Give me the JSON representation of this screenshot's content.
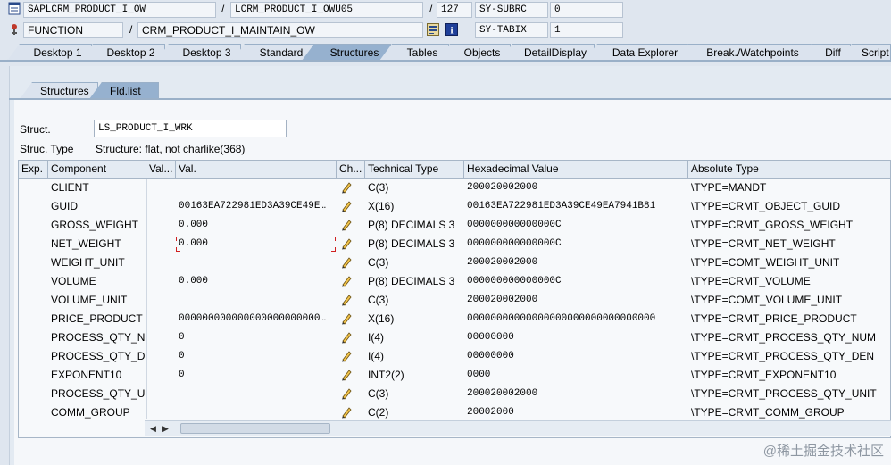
{
  "header": {
    "program": "SAPLCRM_PRODUCT_I_OW",
    "include": "LCRM_PRODUCT_I_OWU05",
    "line": "127",
    "var1_name": "SY-SUBRC",
    "var1_value": "0",
    "event_type": "FUNCTION",
    "event_name": "CRM_PRODUCT_I_MAINTAIN_OW",
    "var2_name": "SY-TABIX",
    "var2_value": "1"
  },
  "tabs": [
    "Desktop 1",
    "Desktop 2",
    "Desktop 3",
    "Standard",
    "Structures",
    "Tables",
    "Objects",
    "DetailDisplay",
    "Data Explorer",
    "Break./Watchpoints",
    "Diff",
    "Script"
  ],
  "active_tab": "Structures",
  "subtabs": [
    "Structures",
    "Fld.list"
  ],
  "active_subtab": "Fld.list",
  "struct": {
    "label": "Struct.",
    "value": "LS_PRODUCT_I_WRK",
    "type_label": "Struc. Type",
    "type_value": "Structure: flat, not charlike(368)"
  },
  "table": {
    "columns": [
      "Exp.",
      "Component",
      "Val...",
      "Val.",
      "Ch...",
      "Technical Type",
      "Hexadecimal Value",
      "Absolute Type"
    ],
    "rows": [
      {
        "component": "CLIENT",
        "val": "",
        "tech": "C(3)",
        "hex": "200020002000",
        "abs": "\\TYPE=MANDT"
      },
      {
        "component": "GUID",
        "val": "00163EA722981ED3A39CE49E…",
        "tech": "X(16)",
        "hex": "00163EA722981ED3A39CE49EA7941B81",
        "abs": "\\TYPE=CRMT_OBJECT_GUID"
      },
      {
        "component": "GROSS_WEIGHT",
        "val": "0.000",
        "tech": "P(8) DECIMALS 3",
        "hex": "000000000000000C",
        "abs": "\\TYPE=CRMT_GROSS_WEIGHT"
      },
      {
        "component": "NET_WEIGHT",
        "val": "0.000",
        "tech": "P(8) DECIMALS 3",
        "hex": "000000000000000C",
        "abs": "\\TYPE=CRMT_NET_WEIGHT"
      },
      {
        "component": "WEIGHT_UNIT",
        "val": "",
        "tech": "C(3)",
        "hex": "200020002000",
        "abs": "\\TYPE=COMT_WEIGHT_UNIT"
      },
      {
        "component": "VOLUME",
        "val": "0.000",
        "tech": "P(8) DECIMALS 3",
        "hex": "000000000000000C",
        "abs": "\\TYPE=CRMT_VOLUME"
      },
      {
        "component": "VOLUME_UNIT",
        "val": "",
        "tech": "C(3)",
        "hex": "200020002000",
        "abs": "\\TYPE=COMT_VOLUME_UNIT"
      },
      {
        "component": "PRICE_PRODUCT",
        "val": "000000000000000000000000…",
        "tech": "X(16)",
        "hex": "00000000000000000000000000000000",
        "abs": "\\TYPE=CRMT_PRICE_PRODUCT"
      },
      {
        "component": "PROCESS_QTY_N…",
        "val": "0",
        "tech": "I(4)",
        "hex": "00000000",
        "abs": "\\TYPE=CRMT_PROCESS_QTY_NUM"
      },
      {
        "component": "PROCESS_QTY_D…",
        "val": "0",
        "tech": "I(4)",
        "hex": "00000000",
        "abs": "\\TYPE=CRMT_PROCESS_QTY_DEN"
      },
      {
        "component": "EXPONENT10",
        "val": "0",
        "tech": "INT2(2)",
        "hex": "0000",
        "abs": "\\TYPE=CRMT_EXPONENT10"
      },
      {
        "component": "PROCESS_QTY_U…",
        "val": "",
        "tech": "C(3)",
        "hex": "200020002000",
        "abs": "\\TYPE=CRMT_PROCESS_QTY_UNIT"
      },
      {
        "component": "COMM_GROUP",
        "val": "",
        "tech": "C(2)",
        "hex": "20002000",
        "abs": "\\TYPE=CRMT_COMM_GROUP"
      }
    ]
  },
  "watermark": "@稀土掘金技术社区"
}
